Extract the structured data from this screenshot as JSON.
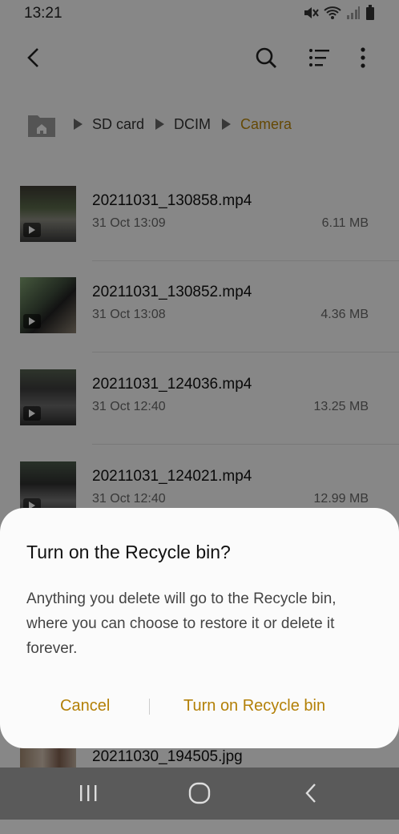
{
  "status": {
    "time": "13:21"
  },
  "toolbar": {
    "back_icon": "back-arrow-icon",
    "search_icon": "search-icon",
    "list_view_icon": "list-view-icon",
    "more_icon": "more-vertical-icon"
  },
  "breadcrumb": {
    "items": [
      "SD card",
      "DCIM",
      "Camera"
    ]
  },
  "files": [
    {
      "name": "20211031_130858.mp4",
      "date": "31 Oct 13:09",
      "size": "6.11 MB"
    },
    {
      "name": "20211031_130852.mp4",
      "date": "31 Oct 13:08",
      "size": "4.36 MB"
    },
    {
      "name": "20211031_124036.mp4",
      "date": "31 Oct 12:40",
      "size": "13.25 MB"
    },
    {
      "name": "20211031_124021.mp4",
      "date": "31 Oct 12:40",
      "size": "12.99 MB"
    },
    {
      "name": "20211030_194505.jpg",
      "date": "",
      "size": ""
    }
  ],
  "dialog": {
    "title": "Turn on the Recycle bin?",
    "body": "Anything you delete will go to the Recycle bin, where you can choose to restore it or delete it forever.",
    "cancel": "Cancel",
    "confirm": "Turn on Recycle bin"
  },
  "colors": {
    "accent": "#b38007",
    "breadcrumb_active": "#b9860b"
  }
}
